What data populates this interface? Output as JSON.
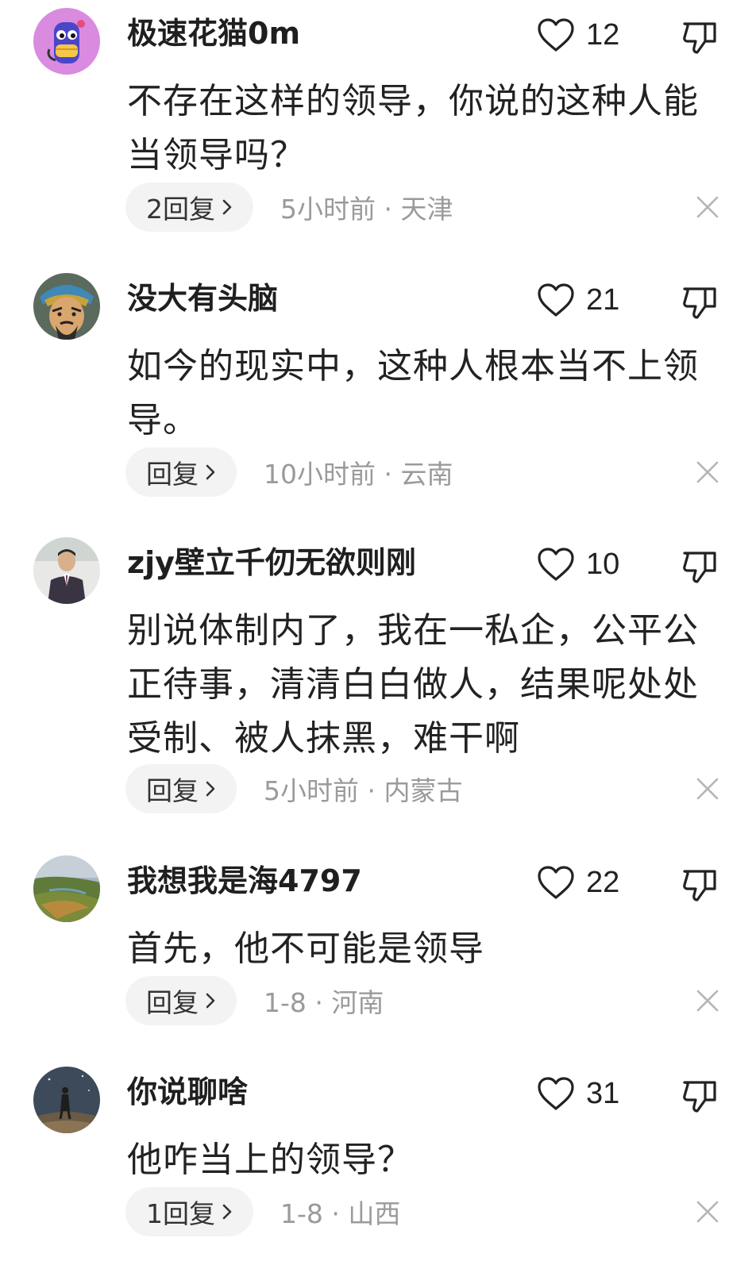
{
  "comments": [
    {
      "username": "极速花猫0m",
      "likes": "12",
      "content": "不存在这样的领导，你说的这种人能当领导吗？",
      "reply_label": "2回复",
      "meta": "5小时前 · 天津",
      "avatar": "cartoon-robot-avatar"
    },
    {
      "username": "没大有头脑",
      "likes": "21",
      "content": "如今的现实中，这种人根本当不上领导。",
      "reply_label": "回复",
      "meta": "10小时前 · 云南",
      "avatar": "warrior-portrait-avatar"
    },
    {
      "username": "zjy壁立千仞无欲则刚",
      "likes": "10",
      "content": "别说体制内了，我在一私企，公平公正待事，清清白白做人，结果呢处处受制、被人抹黑，难干啊",
      "reply_label": "回复",
      "meta": "5小时前 · 内蒙古",
      "avatar": "man-photo-avatar"
    },
    {
      "username": "我想我是海4797",
      "likes": "22",
      "content": "首先，他不可能是领导",
      "reply_label": "回复",
      "meta": "1-8 · 河南",
      "avatar": "landscape-avatar"
    },
    {
      "username": "你说聊啥",
      "likes": "31",
      "content": "他咋当上的领导？",
      "reply_label": "1回复",
      "meta": "1-8 · 山西",
      "avatar": "night-figure-avatar"
    }
  ],
  "colors": {
    "text": "#222222",
    "meta": "#9a9a9a",
    "reply_bg": "#f3f3f3"
  }
}
